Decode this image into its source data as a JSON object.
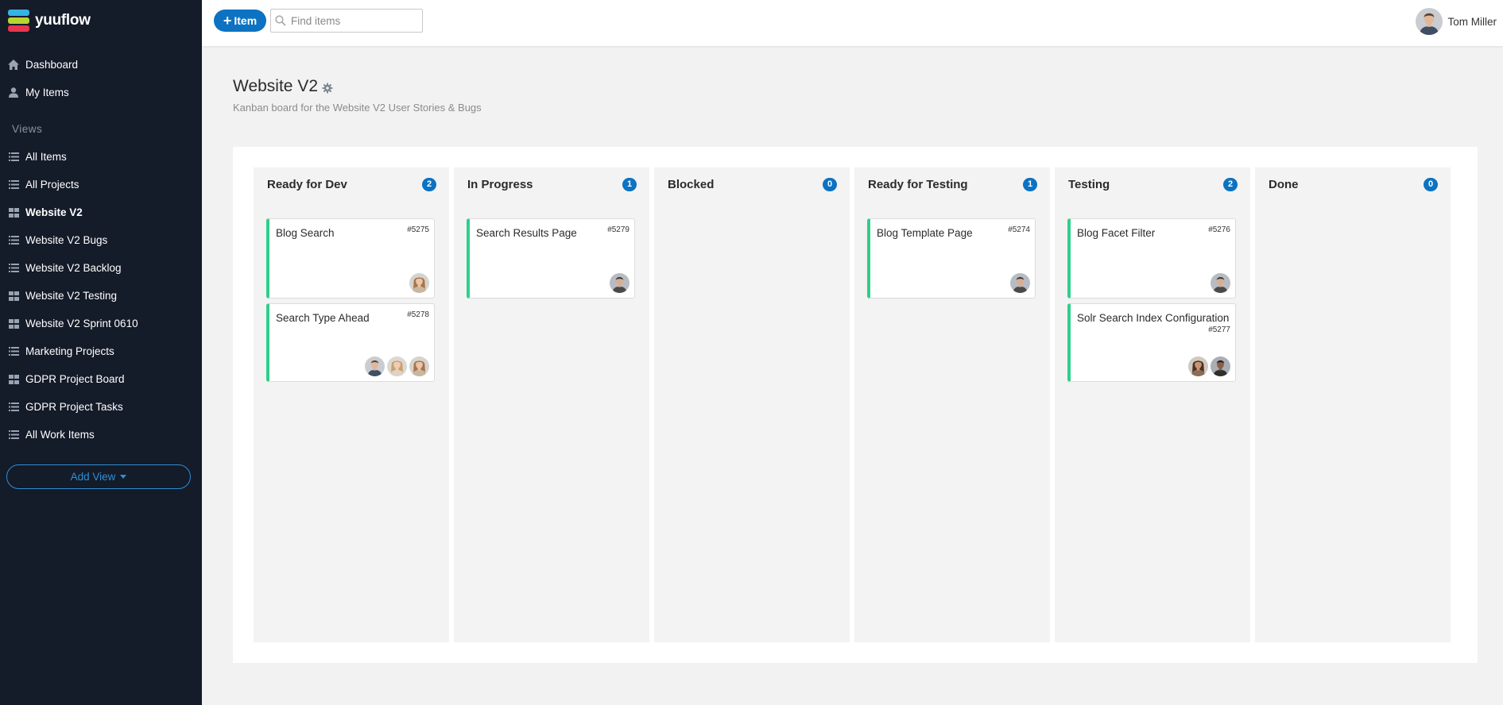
{
  "app": {
    "name": "yuuflow"
  },
  "sidebar": {
    "top_items": [
      {
        "label": "Dashboard",
        "icon": "home-icon"
      },
      {
        "label": "My Items",
        "icon": "user-icon"
      }
    ],
    "views_heading": "Views",
    "views": [
      {
        "label": "All Items",
        "icon": "list-icon"
      },
      {
        "label": "All Projects",
        "icon": "list-icon"
      },
      {
        "label": "Website V2",
        "icon": "grid-icon",
        "active": true
      },
      {
        "label": "Website V2 Bugs",
        "icon": "list-icon"
      },
      {
        "label": "Website V2 Backlog",
        "icon": "list-icon"
      },
      {
        "label": "Website V2 Testing",
        "icon": "grid-icon"
      },
      {
        "label": "Website V2 Sprint 0610",
        "icon": "grid-icon"
      },
      {
        "label": "Marketing Projects",
        "icon": "list-icon"
      },
      {
        "label": "GDPR Project Board",
        "icon": "grid-icon"
      },
      {
        "label": "GDPR Project Tasks",
        "icon": "list-icon"
      },
      {
        "label": "All Work Items",
        "icon": "list-icon"
      }
    ],
    "add_view_label": "Add View"
  },
  "topbar": {
    "add_item_label": "Item",
    "search_placeholder": "Find items",
    "user_name": "Tom Miller"
  },
  "page": {
    "title": "Website V2",
    "subtitle": "Kanban board for the Website V2 User Stories & Bugs"
  },
  "board": {
    "columns": [
      {
        "title": "Ready for Dev",
        "count": "2",
        "cards": [
          {
            "title": "Blog Search",
            "id": "#5275",
            "avatars": [
              "woman-b"
            ]
          },
          {
            "title": "Search Type Ahead",
            "id": "#5278",
            "avatars": [
              "man-a",
              "woman-c",
              "woman-b"
            ]
          }
        ]
      },
      {
        "title": "In Progress",
        "count": "1",
        "cards": [
          {
            "title": "Search Results Page",
            "id": "#5279",
            "avatars": [
              "man-b"
            ]
          }
        ]
      },
      {
        "title": "Blocked",
        "count": "0",
        "cards": []
      },
      {
        "title": "Ready for Testing",
        "count": "1",
        "cards": [
          {
            "title": "Blog Template Page",
            "id": "#5274",
            "avatars": [
              "man-b"
            ]
          }
        ]
      },
      {
        "title": "Testing",
        "count": "2",
        "cards": [
          {
            "title": "Blog Facet Filter",
            "id": "#5276",
            "avatars": [
              "man-b"
            ]
          },
          {
            "title": "Solr Search Index Configuration",
            "id": "#5277",
            "avatars": [
              "woman-d",
              "man-c"
            ]
          }
        ]
      },
      {
        "title": "Done",
        "count": "0",
        "cards": []
      }
    ]
  },
  "colors": {
    "sidebar_bg": "#141b29",
    "primary": "#0d72c1",
    "card_accent": "#2fcf8b",
    "add_view": "#2f8fd6"
  }
}
